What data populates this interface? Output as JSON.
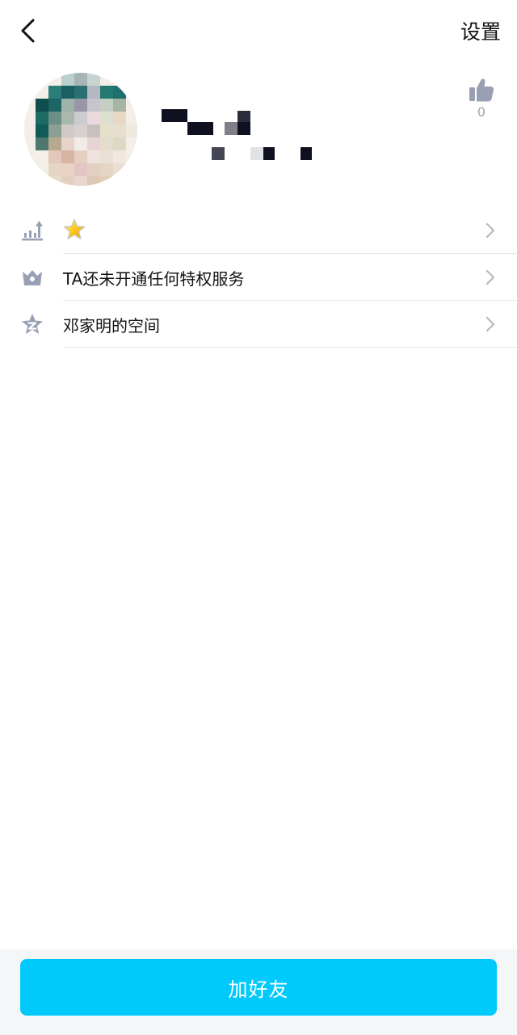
{
  "header": {
    "back_icon": "chevron-left-icon",
    "settings_label": "设置"
  },
  "profile": {
    "like_icon": "thumbs-up-icon",
    "like_count": "0"
  },
  "menu": {
    "items": [
      {
        "icon": "level-up-icon",
        "label": "",
        "badge_icon": "star-icon"
      },
      {
        "icon": "crown-icon",
        "label": "TA还未开通任何特权服务"
      },
      {
        "icon": "qzone-star-icon",
        "label": "邓家明的空间"
      }
    ]
  },
  "footer": {
    "add_friend_label": "加好友"
  },
  "colors": {
    "accent": "#00cafc",
    "icon_gray": "#9aa0b4",
    "text": "#111111"
  }
}
